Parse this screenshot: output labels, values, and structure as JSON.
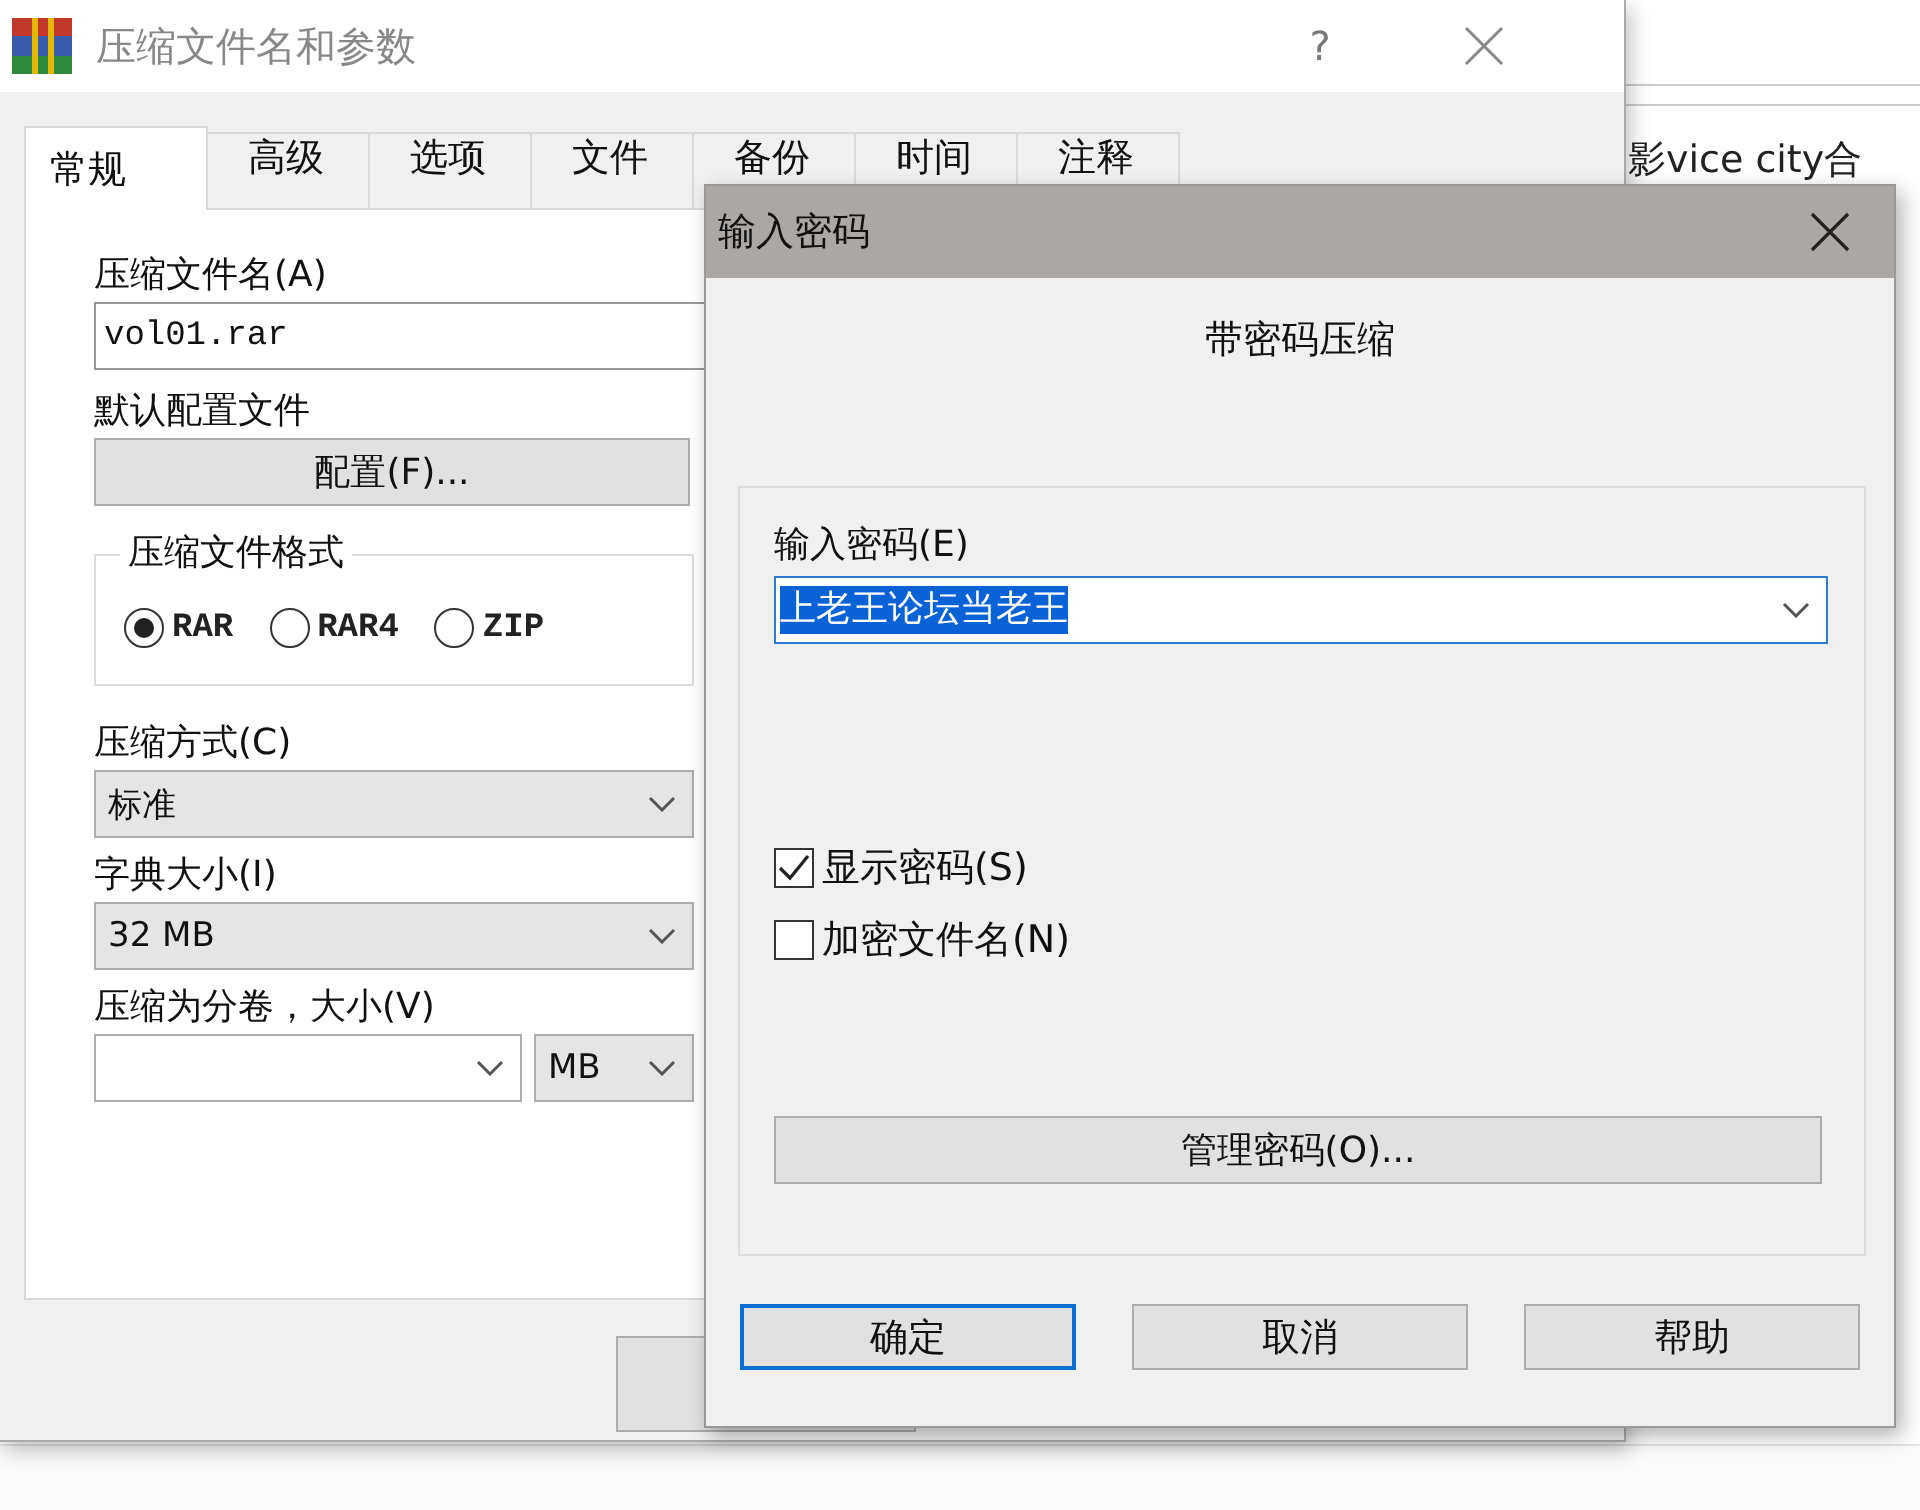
{
  "main_window": {
    "title": "压缩文件名和参数",
    "help": "?",
    "tabs": [
      {
        "label": "常规",
        "selected": true
      },
      {
        "label": "高级",
        "selected": false
      },
      {
        "label": "选项",
        "selected": false
      },
      {
        "label": "文件",
        "selected": false
      },
      {
        "label": "备份",
        "selected": false
      },
      {
        "label": "时间",
        "selected": false
      },
      {
        "label": "注释",
        "selected": false
      }
    ],
    "archive_name": {
      "label": "压缩文件名(A)",
      "value": "vol01.rar"
    },
    "profiles": {
      "label": "默认配置文件",
      "button": "配置(F)..."
    },
    "format": {
      "legend": "压缩文件格式",
      "options": [
        {
          "label": "RAR",
          "selected": true
        },
        {
          "label": "RAR4",
          "selected": false
        },
        {
          "label": "ZIP",
          "selected": false
        }
      ]
    },
    "method": {
      "label": "压缩方式(C)",
      "value": "标准"
    },
    "dictionary": {
      "label": "字典大小(I)",
      "value": "32 MB"
    },
    "split": {
      "label": "压缩为分卷，大小(V)",
      "unit": "MB"
    }
  },
  "background_window": {
    "text": "影vice city合"
  },
  "password_dialog": {
    "title": "输入密码",
    "heading": "带密码压缩",
    "password": {
      "label": "输入密码(E)",
      "value": "上老王论坛当老王",
      "selected": true
    },
    "options": [
      {
        "label": "显示密码(S)",
        "checked": true
      },
      {
        "label": "加密文件名(N)",
        "checked": false
      }
    ],
    "manage_button": "管理密码(O)...",
    "buttons": [
      {
        "label": "确定",
        "default": true
      },
      {
        "label": "取消",
        "default": false
      },
      {
        "label": "帮助",
        "default": false
      }
    ]
  }
}
